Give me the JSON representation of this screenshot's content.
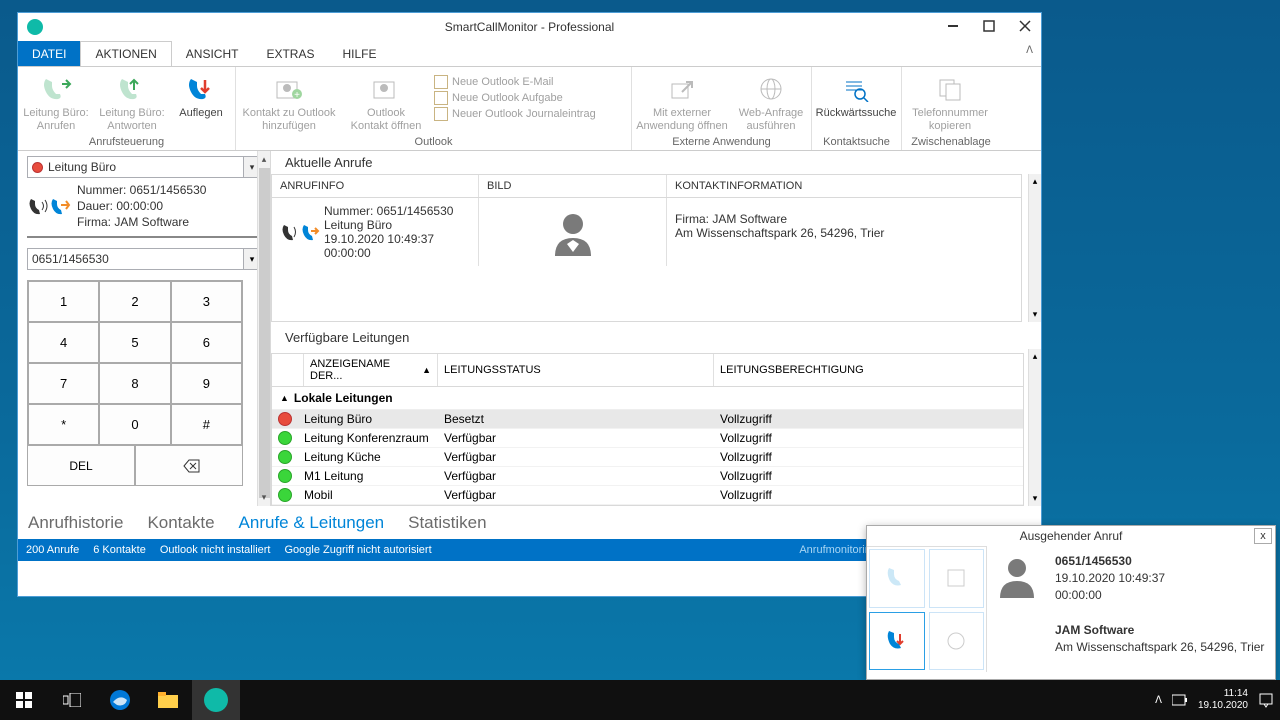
{
  "window": {
    "title": "SmartCallMonitor - Professional"
  },
  "menu": {
    "file": "DATEI",
    "aktionen": "AKTIONEN",
    "ansicht": "ANSICHT",
    "extras": "EXTRAS",
    "hilfe": "HILFE"
  },
  "ribbon": {
    "anrufsteuerung": {
      "label": "Anrufsteuerung",
      "anrufen1": "Leitung Büro:",
      "anrufen2": "Anrufen",
      "antworten1": "Leitung Büro:",
      "antworten2": "Antworten",
      "auflegen": "Auflegen"
    },
    "outlook": {
      "label": "Outlook",
      "add1": "Kontakt zu Outlook",
      "add2": "hinzufügen",
      "open1": "Outlook",
      "open2": "Kontakt öffnen",
      "email": "Neue Outlook E-Mail",
      "aufgabe": "Neue Outlook Aufgabe",
      "journal": "Neuer Outlook Journaleintrag"
    },
    "externe": {
      "label": "Externe Anwendung",
      "ext1": "Mit externer",
      "ext2": "Anwendung öffnen",
      "web1": "Web-Anfrage",
      "web2": "ausführen"
    },
    "kontaktsuche": {
      "label": "Kontaktsuche",
      "rueck": "Rückwärtssuche"
    },
    "zwischenablage": {
      "label": "Zwischenablage",
      "tel1": "Telefonnummer",
      "tel2": "kopieren"
    }
  },
  "leftpanel": {
    "line_selected": "Leitung Büro",
    "info_number_label": "Nummer: ",
    "info_number": "0651/1456530",
    "info_duration_label": "Dauer: ",
    "info_duration": "00:00:00",
    "info_firm_label": "Firma: ",
    "info_firm": "JAM Software",
    "dial_display": "0651/1456530",
    "keys": [
      "1",
      "2",
      "3",
      "4",
      "5",
      "6",
      "7",
      "8",
      "9",
      "*",
      "0",
      "#"
    ],
    "del": "DEL"
  },
  "currentCalls": {
    "title": "Aktuelle Anrufe",
    "col_info": "ANRUFINFO",
    "col_bild": "BILD",
    "col_contact": "KONTAKTINFORMATION",
    "row": {
      "number": "Nummer: 0651/1456530",
      "line": "Leitung Büro",
      "timestamp": "19.10.2020 10:49:37",
      "dur": "00:00:00",
      "firm": "Firma: JAM Software",
      "address": "Am Wissenschaftspark 26, 54296, Trier"
    }
  },
  "availableLines": {
    "title": "Verfügbare Leitungen",
    "col_name": "ANZEIGENAME DER...",
    "col_status": "LEITUNGSSTATUS",
    "col_perm": "LEITUNGSBERECHTIGUNG",
    "group": "Lokale Leitungen",
    "rows": [
      {
        "name": "Leitung Büro",
        "status": "Besetzt",
        "perm": "Vollzugriff",
        "color": "red"
      },
      {
        "name": "Leitung Konferenzraum",
        "status": "Verfügbar",
        "perm": "Vollzugriff",
        "color": "green"
      },
      {
        "name": "Leitung Küche",
        "status": "Verfügbar",
        "perm": "Vollzugriff",
        "color": "green"
      },
      {
        "name": "M1 Leitung",
        "status": "Verfügbar",
        "perm": "Vollzugriff",
        "color": "green"
      },
      {
        "name": "Mobil",
        "status": "Verfügbar",
        "perm": "Vollzugriff",
        "color": "green"
      }
    ]
  },
  "bottomTabs": {
    "anrufhistorie": "Anrufhistorie",
    "kontakte": "Kontakte",
    "anrufe_leitungen": "Anrufe & Leitungen",
    "statistiken": "Statistiken"
  },
  "statusbar": {
    "calls": "200 Anrufe",
    "contacts": "6 Kontakte",
    "outlook": "Outlook nicht installiert",
    "google": "Google Zugriff nicht autorisiert",
    "monitoring": "Anrufmonitoring aktiviert."
  },
  "popup": {
    "title": "Ausgehender Anruf",
    "close": "x",
    "number": "0651/1456530",
    "timestamp": "19.10.2020 10:49:37",
    "dur": "00:00:00",
    "firm": "JAM Software",
    "address": "Am Wissenschaftspark 26, 54296, Trier"
  },
  "taskbar": {
    "time": "11:14",
    "date": "19.10.2020"
  }
}
